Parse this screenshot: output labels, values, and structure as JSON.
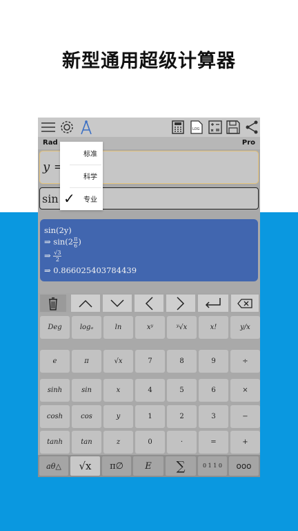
{
  "headline": "新型通用超级计算器",
  "toolbar": {
    "icons": [
      "menu-icon",
      "gear-icon",
      "compass-icon",
      "calculator-icon",
      "log-icon",
      "variables-icon",
      "save-icon",
      "share-icon"
    ],
    "log_label": "LOG"
  },
  "status": {
    "angle_mode": "Rad",
    "mode": "Pro"
  },
  "expression": {
    "text": "y ="
  },
  "input": {
    "text": "sin ("
  },
  "result": {
    "line1": "sin(2y)",
    "line2_pre": "⇒ sin(2",
    "line2_num": "π",
    "line2_den": "6",
    "line2_post": ")",
    "line3_pre": "⇒",
    "line3_num": "√3",
    "line3_den": "2",
    "line4": "⇒ 0.866025403784439"
  },
  "menu": {
    "items": [
      "标准",
      "科学",
      "专业"
    ],
    "selected_index": 2,
    "check": "✓"
  },
  "nav": {
    "trash": "🗑",
    "up": "︿",
    "down": "﹀",
    "left": "〈",
    "right": "〉",
    "enter": "↵",
    "delete": "⌫"
  },
  "keys": [
    [
      "Deg",
      "logₐ",
      "ln",
      "xʸ",
      "ʸ√x",
      "x!",
      "y/x"
    ],
    [
      "e",
      "π",
      "√x",
      "7",
      "8",
      "9",
      "÷"
    ],
    [
      "sinh",
      "sin",
      "x",
      "4",
      "5",
      "6",
      "×"
    ],
    [
      "cosh",
      "cos",
      "y",
      "1",
      "2",
      "3",
      "−"
    ],
    [
      "tanh",
      "tan",
      "z",
      "0",
      "·",
      "=",
      "+"
    ]
  ],
  "bottom": [
    "aθ△",
    "√x",
    "π∅",
    "E",
    "∑",
    "0 1 1 0",
    "ooo"
  ]
}
